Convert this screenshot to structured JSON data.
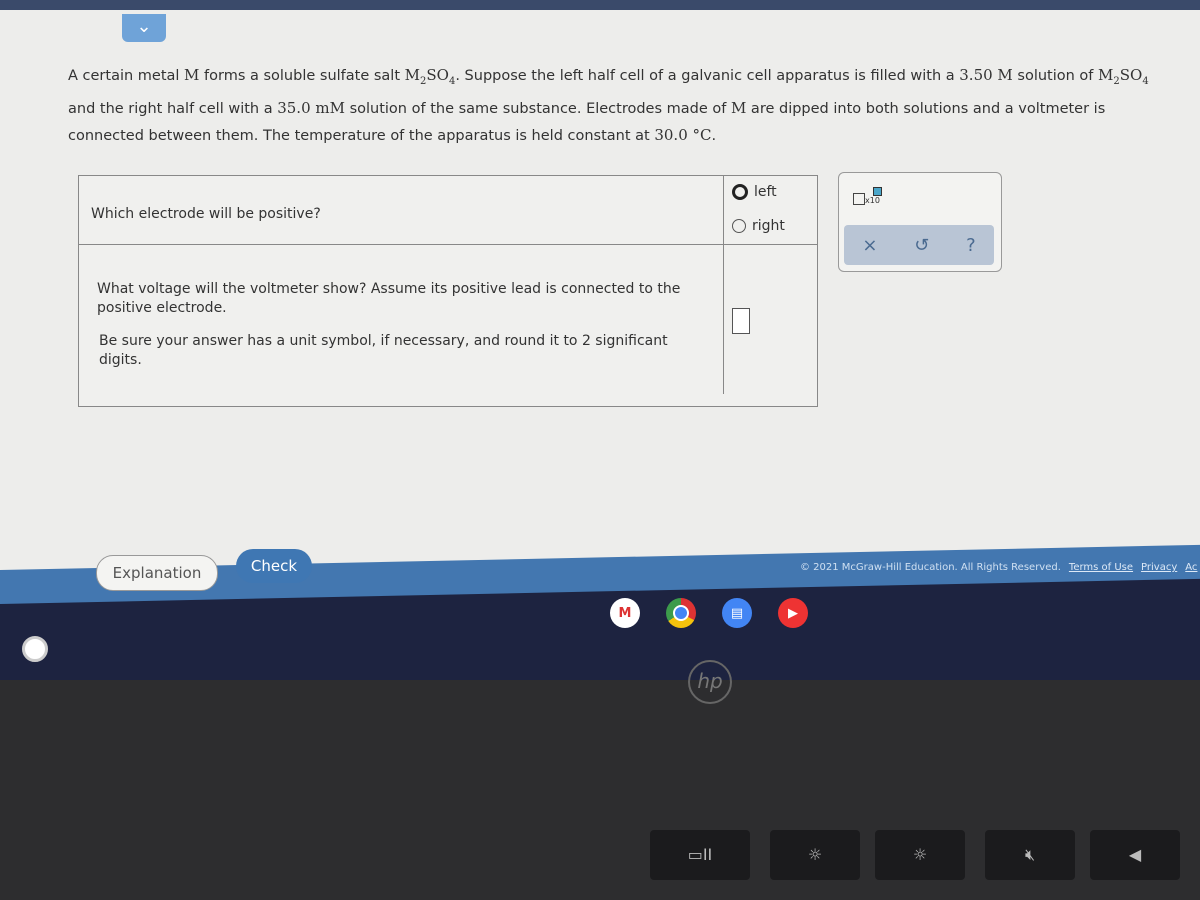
{
  "nav": {
    "chevron": "⌄"
  },
  "problem": {
    "p1": "A certain metal ",
    "metal": "M",
    "p2": " forms a soluble sulfate salt ",
    "salt_a": "M",
    "salt_sub1": "2",
    "salt_b": "SO",
    "salt_sub2": "4",
    "p3": ". Suppose the left half cell of a galvanic cell apparatus is filled with a ",
    "conc_left": "3.50 M",
    "p4": " solution of ",
    "p5": " and the right half cell with a ",
    "conc_right": "35.0 mM",
    "p6": " solution of the same substance. Electrodes made of ",
    "p7": " are dipped into both solutions and a voltmeter is connected between them. The temperature of the apparatus is held constant at ",
    "temp": "30.0 °C",
    "p8": "."
  },
  "question1": {
    "text": "Which electrode will be positive?",
    "options": [
      "left",
      "right"
    ],
    "selected": "left"
  },
  "question2": {
    "text": "What voltage will the voltmeter show? Assume its positive lead is connected to the positive electrode.",
    "hint": "Be sure your answer has a unit symbol, if necessary, and round it to 2 significant digits.",
    "answer_value": ""
  },
  "toolbox": {
    "x10_label": "x10",
    "clear": "×",
    "undo": "↺",
    "help": "?"
  },
  "buttons": {
    "explanation": "Explanation",
    "check": "Check"
  },
  "footer": {
    "copyright": "© 2021 McGraw-Hill Education. All Rights Reserved.",
    "terms": "Terms of Use",
    "privacy": "Privacy",
    "accessibility": "Ac"
  },
  "taskbar": {
    "apps": [
      "gmail-icon",
      "chrome-icon",
      "docs-icon",
      "youtube-icon"
    ]
  },
  "colors": {
    "accent": "#3f77b3",
    "footer": "#4377b0",
    "taskbar": "#1d2340"
  }
}
